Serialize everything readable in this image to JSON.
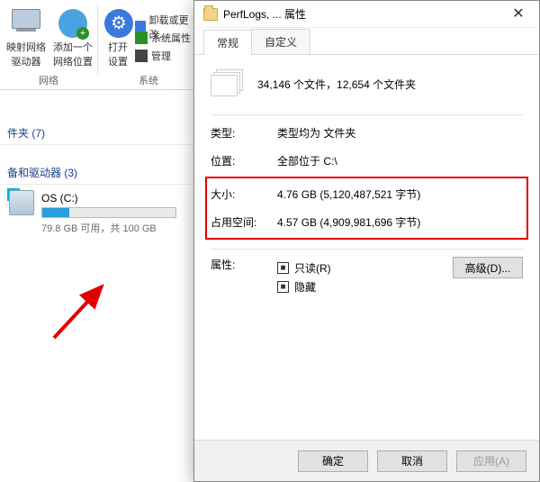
{
  "ribbon": {
    "item1_l1": "映射网络",
    "item1_l2": "驱动器",
    "item2_l1": "添加一个",
    "item2_l2": "网络位置",
    "section1": "网络",
    "item3_l1": "打开",
    "item3_l2": "设置",
    "side1": "卸载或更改…",
    "side2": "系统属性",
    "side3": "管理",
    "section2": "系统"
  },
  "explorer": {
    "group_folders": "件夹 (7)",
    "group_drives": "备和驱动器 (3)",
    "drive_name": "OS (C:)",
    "drive_fill_pct": 20,
    "drive_sub": "79.8 GB 可用，共 100 GB"
  },
  "dialog": {
    "title": "PerfLogs, ... 属性",
    "tab_general": "常规",
    "tab_custom": "自定义",
    "summary": "34,146 个文件，12,654 个文件夹",
    "rows": {
      "type_k": "类型:",
      "type_v": "类型均为 文件夹",
      "loc_k": "位置:",
      "loc_v": "全部位于 C:\\",
      "size_k": "大小:",
      "size_v": "4.76 GB (5,120,487,521 字节)",
      "disk_k": "占用空间:",
      "disk_v": "4.57 GB (4,909,981,696 字节)",
      "attr_k": "属性:"
    },
    "readonly": "只读(R)",
    "hidden": "隐藏",
    "advanced": "高级(D)...",
    "ok": "确定",
    "cancel": "取消",
    "apply": "应用(A)"
  }
}
